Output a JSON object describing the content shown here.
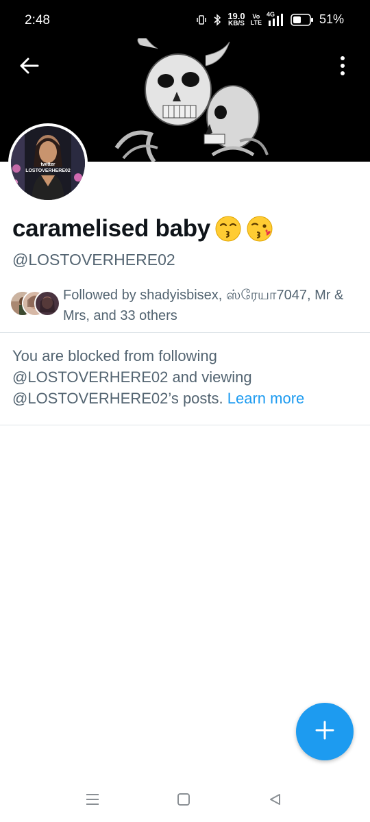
{
  "status_bar": {
    "time": "2:48",
    "net_speed_value": "19.0",
    "net_speed_unit": "KB/S",
    "volte_top": "Vo",
    "volte_bottom": "LTE",
    "network": "4G",
    "battery_percent": "51%",
    "battery_level": 0.51,
    "icons": [
      "vibrate-icon",
      "bluetooth-icon",
      "signal-icon",
      "battery-icon"
    ]
  },
  "header": {
    "back_icon": "arrow-left-icon",
    "more_icon": "more-vertical-icon"
  },
  "profile": {
    "display_name": "caramelised baby",
    "emojis": [
      "kissing-face-smiling-eyes-emoji",
      "face-blowing-kiss-emoji"
    ],
    "handle": "@LOSTOVERHERE02",
    "avatar_text_line1": "twitter",
    "avatar_text_line2": "LOSTOVERHERE02",
    "followed_by_text": "Followed by shadyisbisex, ஸ்ரேயா7047, Mr & Mrs, and 33 others"
  },
  "blocked_notice": {
    "text": "You are blocked from following @LOSTOVERHERE02 and viewing @LOSTOVERHERE02’s posts.",
    "link_label": "Learn more"
  },
  "fab": {
    "icon": "plus-icon"
  },
  "nav": {
    "icons": [
      "menu-icon",
      "home-square-icon",
      "back-triangle-icon"
    ]
  },
  "colors": {
    "accent": "#1d9bf0",
    "secondary_text": "#536471",
    "primary_text": "#0f1419",
    "divider": "#dde3e8"
  }
}
